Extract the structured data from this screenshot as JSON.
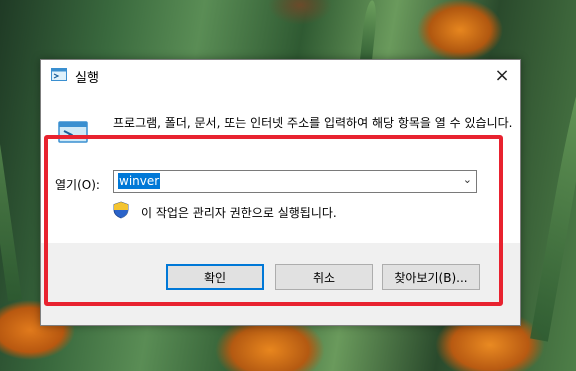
{
  "window": {
    "title": "실행"
  },
  "dialog": {
    "description": "프로그램, 폴더, 문서, 또는 인터넷 주소를 입력하여 해당 항목을 열 수 있습니다.",
    "open_label": "열기(O):",
    "open_value": "winver",
    "admin_note": "이 작업은 관리자 권한으로 실행됩니다."
  },
  "buttons": {
    "ok": "확인",
    "cancel": "취소",
    "browse": "찾아보기(B)..."
  },
  "icons": {
    "close": "×",
    "dropdown": "chevron-down-icon",
    "shield": "uac-shield-icon",
    "run": "run-icon"
  },
  "colors": {
    "highlight": "#e8222f",
    "accent": "#0078d7"
  }
}
